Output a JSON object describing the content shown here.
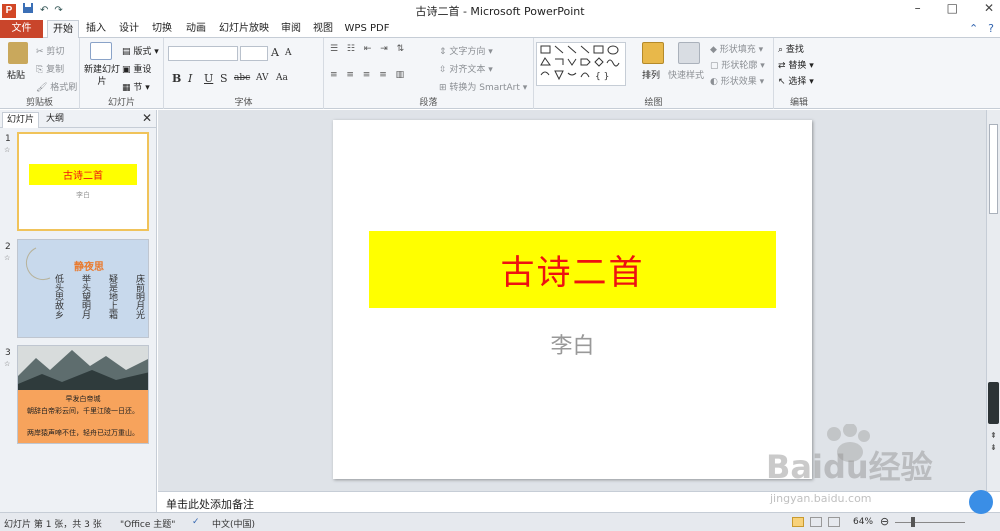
{
  "window": {
    "title": "古诗二首 - Microsoft PowerPoint",
    "app_icon": "P",
    "controls": [
      "–",
      "□",
      "✕"
    ]
  },
  "qat": {
    "undo": "↶",
    "redo": "↷",
    "save": "💾"
  },
  "tabs": [
    {
      "label": "文件"
    },
    {
      "label": "开始"
    },
    {
      "label": "插入"
    },
    {
      "label": "设计"
    },
    {
      "label": "切换"
    },
    {
      "label": "动画"
    },
    {
      "label": "幻灯片放映"
    },
    {
      "label": "审阅"
    },
    {
      "label": "视图"
    },
    {
      "label": "WPS PDF"
    }
  ],
  "ribbon": {
    "clipboard": {
      "label": "剪贴板",
      "paste": "粘贴",
      "cut": "剪切",
      "copy": "复制",
      "format_painter": "格式刷"
    },
    "slides": {
      "label": "幻灯片",
      "new_slide": "新建幻灯片",
      "layout": "版式",
      "reset": "重设",
      "section": "节"
    },
    "font": {
      "label": "字体",
      "bold": "B",
      "italic": "I",
      "underline": "U",
      "shadow": "S",
      "strike": "abc",
      "spacing": "AV",
      "case": "Aa",
      "grow": "A",
      "shrink": "A"
    },
    "paragraph": {
      "label": "段落",
      "text_direction": "文字方向",
      "align_text": "对齐文本",
      "smartart": "转换为 SmartArt"
    },
    "drawing": {
      "label": "绘图",
      "arrange": "排列",
      "quick_styles": "快速样式",
      "fill": "形状填充",
      "outline": "形状轮廓",
      "effects": "形状效果"
    },
    "editing": {
      "label": "编辑",
      "find": "查找",
      "replace": "替换",
      "select": "选择"
    }
  },
  "panel": {
    "tabs": [
      "幻灯片",
      "大纲"
    ],
    "thumbs": [
      {
        "num": "1",
        "title": "古诗二首",
        "sub": "李白"
      },
      {
        "num": "2",
        "title": "静夜思",
        "lines": [
          "床前明月光",
          "疑是地上霜",
          "举头望明月",
          "低头思故乡"
        ]
      },
      {
        "num": "3",
        "title": "早发白帝城",
        "line1": "朝辞白帝彩云间，千里江陵一日还。",
        "line2": "两岸猿声啼不住，轻舟已过万重山。"
      }
    ]
  },
  "slide": {
    "title": "古诗二首",
    "subtitle": "李白",
    "title_bg": "#ffff00",
    "title_color": "#ee1111"
  },
  "notes": {
    "placeholder": "单击此处添加备注"
  },
  "status": {
    "slide_info": "幻灯片 第 1 张，共 3 张",
    "theme": "\"Office 主题\"",
    "language": "中文(中国)",
    "zoom": "64%"
  },
  "watermark": {
    "brand": "Baidu经验",
    "url": "jingyan.baidu.com"
  }
}
